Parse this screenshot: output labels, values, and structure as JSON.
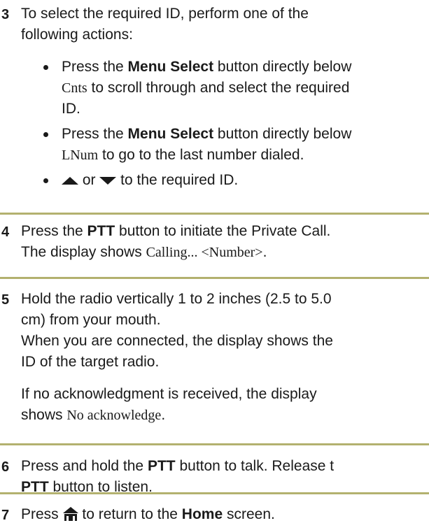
{
  "steps": [
    {
      "number": "3",
      "lines": [
        "To select the required ID, perform one of the",
        "following actions:"
      ],
      "bullets": [
        {
          "pre": "Press the ",
          "bold": "Menu Select",
          "post": " button directly below",
          "line2_code": "Cnts",
          "line2_rest": " to scroll through and select the required",
          "line3": "ID."
        },
        {
          "pre": "Press the ",
          "bold": "Menu Select",
          "post": " button directly below",
          "line2_code": "LNum",
          "line2_rest": " to go to the last number dialed."
        },
        {
          "middle": " or ",
          "rest": " to the required ID.",
          "icons": [
            "up-arrow-icon",
            "down-arrow-icon"
          ]
        }
      ]
    },
    {
      "number": "4",
      "l1_pre": "Press the ",
      "l1_bold": "PTT",
      "l1_post": " button to initiate the Private Call.",
      "l2_pre": "The display shows ",
      "l2_code": "Calling... <Number>",
      "l2_post": "."
    },
    {
      "number": "5",
      "lines": [
        "Hold the radio vertically 1 to 2 inches (2.5 to 5.0",
        "cm) from your mouth.",
        "When you are connected, the display shows the",
        "ID of the target radio."
      ],
      "note_line1": "If no acknowledgment is received, the display",
      "note_pre": "shows ",
      "note_code": "No acknowledge",
      "note_post": "."
    },
    {
      "number": "6",
      "l1_pre": "Press and hold the ",
      "l1_bold": "PTT",
      "l1_post": " button to talk. Release t",
      "l2_bold": "PTT",
      "l2_post": " button to listen."
    },
    {
      "number": "7",
      "pre": "Press ",
      "icon": "home-icon",
      "mid": " to return to the ",
      "bold": "Home",
      "post": " screen."
    }
  ],
  "rule_color": "#b3b16f"
}
